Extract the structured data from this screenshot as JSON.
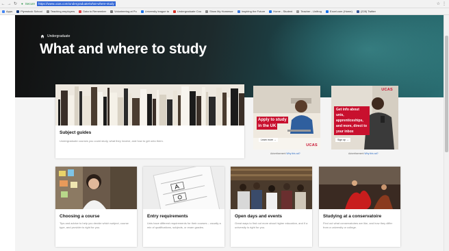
{
  "browser": {
    "secure_label": "Secure",
    "url": "https://www.ucas.com/undergraduate/what-where-study",
    "bookmarks": [
      "Apps",
      "Plymstock School",
      "Teaching employers",
      "Data to Remember",
      "Volunteering at Pu",
      "University league ta",
      "Undergraduate Cou",
      "Show My Homewor",
      "Inspiring the Future",
      "Home - Student",
      "Teacher - Unifrog",
      "Excel.com (Home)",
      "(228) Twitter"
    ],
    "bookmark_colors": [
      "#4285f4",
      "#1a3d7c",
      "#888888",
      "#e04040",
      "#777777",
      "#1a73e8",
      "#d93025",
      "#888888",
      "#3c78d8",
      "#1a73e8",
      "#999999",
      "#1a73e8",
      "#3b5998",
      "#1da1f2"
    ]
  },
  "hero": {
    "breadcrumb": "Undergraduate",
    "title": "What and where to study"
  },
  "subject_guides": {
    "title": "Subject guides",
    "description": "Undergraduate courses you could study, what they involve, and how to get onto them."
  },
  "adverts": [
    {
      "headline_line1": "Apply to study",
      "headline_line2": "in the UK",
      "button": "Learn more →",
      "logo": "UCAS",
      "caption": "Advertisement",
      "why": "Why this ad?"
    },
    {
      "logo": "UCAS",
      "headline_lines": [
        "Get info about",
        "unis, apprenticeships,",
        "and more, direct to",
        "your inbox"
      ],
      "button": "Sign up →",
      "caption": "Advertisement",
      "why": "Why this ad?"
    }
  ],
  "cards": [
    {
      "title": "Choosing a course",
      "description": "Tips and advice to help you decide which subject, course type, and provider is right for you."
    },
    {
      "title": "Entry requirements",
      "description": "Unis have different requirements for their courses – usually a mix of qualifications, subjects, or exam grades."
    },
    {
      "title": "Open days and events",
      "description": "Great ways to find out more about higher education, and if a university is right for you."
    },
    {
      "title": "Studying at a conservatoire",
      "description": "Find out what conservatoires are like, and how they differ from a university or college."
    }
  ]
}
